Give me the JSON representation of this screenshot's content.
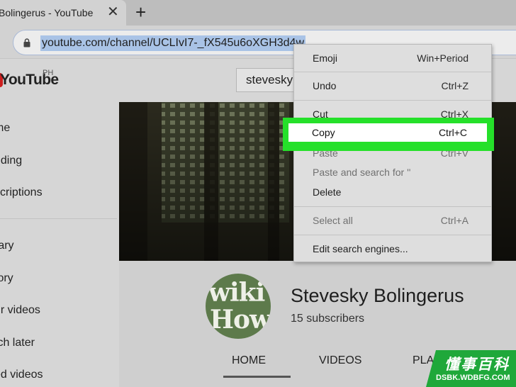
{
  "browser": {
    "tab_title": "Bolingerus - YouTube",
    "close_glyph": "✕",
    "new_tab_glyph": "+",
    "url": "youtube.com/channel/UCLIvI7-_fX545u6oXGH3d4w"
  },
  "youtube": {
    "logo_text": "YouTube",
    "region": "PH",
    "search_value": "stevesky",
    "sidebar": [
      "me",
      "nding",
      "scriptions",
      "rary",
      "tory",
      "ur videos",
      "tch later",
      "ed videos"
    ],
    "channel": {
      "avatar_line1": "wiki",
      "avatar_line2": "How",
      "name": "Stevesky Bolingerus",
      "subscribers": "15 subscribers",
      "tabs": [
        "HOME",
        "VIDEOS",
        "PLA"
      ]
    }
  },
  "context_menu": {
    "emoji": {
      "label": "Emoji",
      "shortcut": "Win+Period"
    },
    "undo": {
      "label": "Undo",
      "shortcut": "Ctrl+Z"
    },
    "cut": {
      "label": "Cut",
      "shortcut": "Ctrl+X"
    },
    "copy": {
      "label": "Copy",
      "shortcut": "Ctrl+C"
    },
    "paste": {
      "label": "Paste",
      "shortcut": "Ctrl+V"
    },
    "paste_search": {
      "label": "Paste and search for ''"
    },
    "delete": {
      "label": "Delete"
    },
    "select_all": {
      "label": "Select all",
      "shortcut": "Ctrl+A"
    },
    "edit_engines": {
      "label": "Edit search engines..."
    }
  },
  "watermark": {
    "line1": "懂事百科",
    "line2": "DSBK.WDBFG.COM"
  },
  "colors": {
    "highlight": "#25e02a",
    "url_selection": "#a9c3e6",
    "youtube_red": "#cc1f1f"
  }
}
